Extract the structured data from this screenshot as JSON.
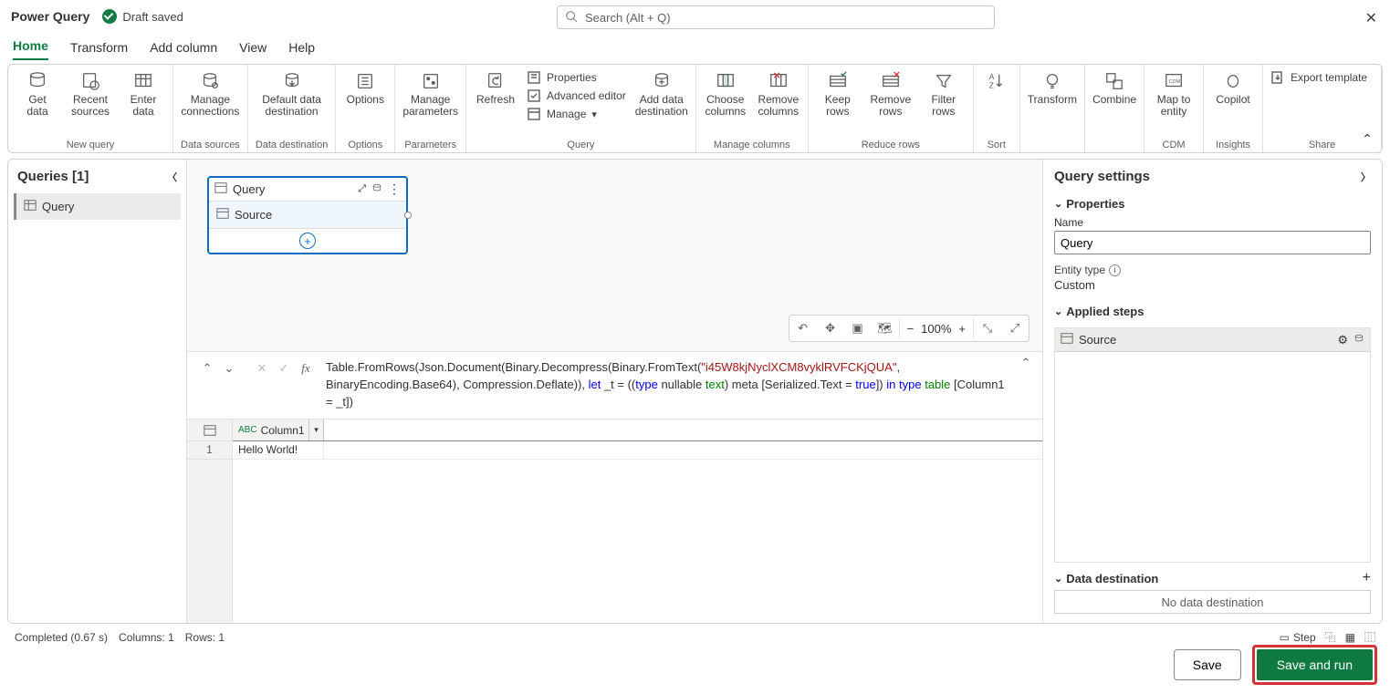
{
  "app_title": "Power Query",
  "save_status": "Draft saved",
  "search_placeholder": "Search (Alt + Q)",
  "tabs": {
    "home": "Home",
    "transform": "Transform",
    "add_column": "Add column",
    "view": "View",
    "help": "Help"
  },
  "ribbon": {
    "new_query": {
      "get_data": "Get\ndata",
      "recent_sources": "Recent\nsources",
      "enter_data": "Enter\ndata",
      "label": "New query"
    },
    "data_sources": {
      "manage_connections": "Manage\nconnections",
      "label": "Data sources"
    },
    "data_destination_grp": {
      "default_destination": "Default data\ndestination",
      "label": "Data destination"
    },
    "options_grp": {
      "options": "Options",
      "label": "Options"
    },
    "parameters_grp": {
      "manage_parameters": "Manage\nparameters",
      "label": "Parameters"
    },
    "query_grp": {
      "refresh": "Refresh",
      "properties": "Properties",
      "advanced_editor": "Advanced editor",
      "manage": "Manage",
      "add_destination": "Add data\ndestination",
      "label": "Query"
    },
    "manage_columns": {
      "choose": "Choose\ncolumns",
      "remove": "Remove\ncolumns",
      "label": "Manage columns"
    },
    "reduce_rows": {
      "keep": "Keep\nrows",
      "remove": "Remove\nrows",
      "filter": "Filter\nrows",
      "label": "Reduce rows"
    },
    "sort": {
      "label": "Sort"
    },
    "transform_btn": "Transform",
    "combine_btn": "Combine",
    "cdm": {
      "map": "Map to\nentity",
      "label": "CDM"
    },
    "insights": {
      "copilot": "Copilot",
      "label": "Insights"
    },
    "share": {
      "export": "Export template",
      "label": "Share"
    }
  },
  "queries": {
    "header": "Queries [1]",
    "item": "Query"
  },
  "diagram": {
    "card_title": "Query",
    "step": "Source"
  },
  "view_toolbar": {
    "zoom": "100%"
  },
  "formula": {
    "prefix": "Table.FromRows(Json.Document(Binary.Decompress(Binary.FromText(",
    "string": "\"i45W8kjNyclXCM8vyklRVFCKjQUA\"",
    "mid": ", BinaryEncoding.Base64), Compression.Deflate)), ",
    "let": "let",
    "let_body": " _t = ((",
    "type1": "type",
    "nullable": " nullable ",
    "text": "text",
    "meta": ") meta [Serialized.Text = ",
    "true": "true",
    "close1": "]) ",
    "in": "in",
    "sp": " ",
    "type2": "type",
    "sp2": " ",
    "table": "table",
    "tail": " [Column1 = _t])"
  },
  "grid": {
    "col1": "Column1",
    "row1_num": "1",
    "cell1": "Hello World!"
  },
  "settings": {
    "header": "Query settings",
    "properties": "Properties",
    "name_label": "Name",
    "name_value": "Query",
    "entity_type_label": "Entity type",
    "entity_type_value": "Custom",
    "applied_steps": "Applied steps",
    "step1": "Source",
    "data_destination": "Data destination",
    "no_destination": "No data destination"
  },
  "status": {
    "completed": "Completed (0.67 s)",
    "columns": "Columns: 1",
    "rows": "Rows: 1",
    "step_btn": "Step"
  },
  "buttons": {
    "save": "Save",
    "save_run": "Save and run"
  }
}
